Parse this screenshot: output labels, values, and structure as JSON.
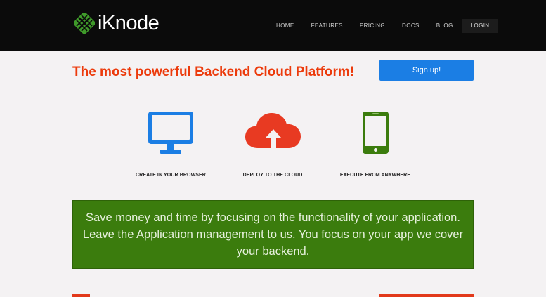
{
  "brand": {
    "name": "iKnode",
    "logo_color": "#3f9a2a"
  },
  "nav": {
    "items": [
      "HOME",
      "FEATURES",
      "PRICING",
      "DOCS",
      "BLOG"
    ],
    "login": "LOGIN"
  },
  "hero": {
    "title": "The most powerful Backend Cloud Platform!",
    "signup_label": "Sign up!"
  },
  "features": [
    {
      "icon": "monitor-icon",
      "label": "CREATE IN YOUR BROWSER",
      "color": "#1b7ee4"
    },
    {
      "icon": "cloud-upload-icon",
      "label": "DEPLOY TO THE CLOUD",
      "color": "#e83a22"
    },
    {
      "icon": "smartphone-icon",
      "label": "EXECUTE FROM ANYWHERE",
      "color": "#3b7c0d"
    }
  ],
  "banner": {
    "text": "Save money and time by focusing on the functionality of your application. Leave the Application management to us. You focus on your app we cover your backend."
  },
  "colors": {
    "accent_red": "#ec3b0c",
    "accent_blue": "#1b7ee4",
    "accent_green": "#3b7c0d",
    "navbar": "#0b0b0b"
  }
}
